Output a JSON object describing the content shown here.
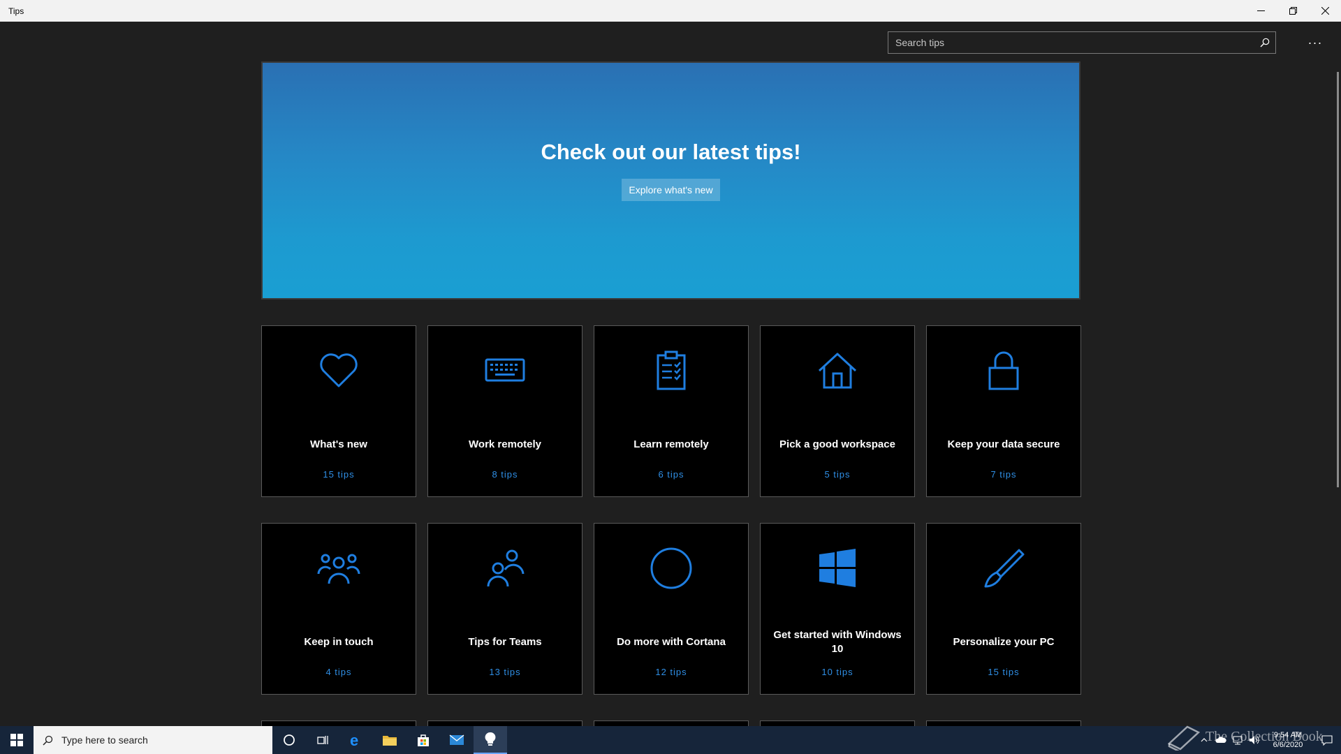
{
  "window": {
    "title": "Tips"
  },
  "search": {
    "placeholder": "Search tips"
  },
  "more_label": "···",
  "hero": {
    "title": "Check out our latest tips!",
    "button_label": "Explore what's new"
  },
  "tiles": [
    {
      "title": "What's new",
      "count": "15 tips",
      "icon": "heart-icon"
    },
    {
      "title": "Work remotely",
      "count": "8 tips",
      "icon": "keyboard-icon"
    },
    {
      "title": "Learn remotely",
      "count": "6 tips",
      "icon": "clipboard-icon"
    },
    {
      "title": "Pick a good workspace",
      "count": "5 tips",
      "icon": "home-icon"
    },
    {
      "title": "Keep your data secure",
      "count": "7 tips",
      "icon": "lock-icon"
    },
    {
      "title": "Keep in touch",
      "count": "4 tips",
      "icon": "people-icon"
    },
    {
      "title": "Tips for Teams",
      "count": "13 tips",
      "icon": "team-icon"
    },
    {
      "title": "Do more with Cortana",
      "count": "12 tips",
      "icon": "cortana-icon"
    },
    {
      "title": "Get started with Windows 10",
      "count": "10 tips",
      "icon": "windows-icon"
    },
    {
      "title": "Personalize your PC",
      "count": "15 tips",
      "icon": "brush-icon"
    }
  ],
  "taskbar": {
    "search_placeholder": "Type here to search",
    "clock_time": "9:54 AM",
    "clock_date": "6/6/2020"
  },
  "watermark": {
    "text": "The Collection Book"
  },
  "colors": {
    "accent": "#2f8fe6",
    "icon": "#1f7ee0",
    "tile_bg": "#000000",
    "app_bg": "#1f1f1f"
  }
}
